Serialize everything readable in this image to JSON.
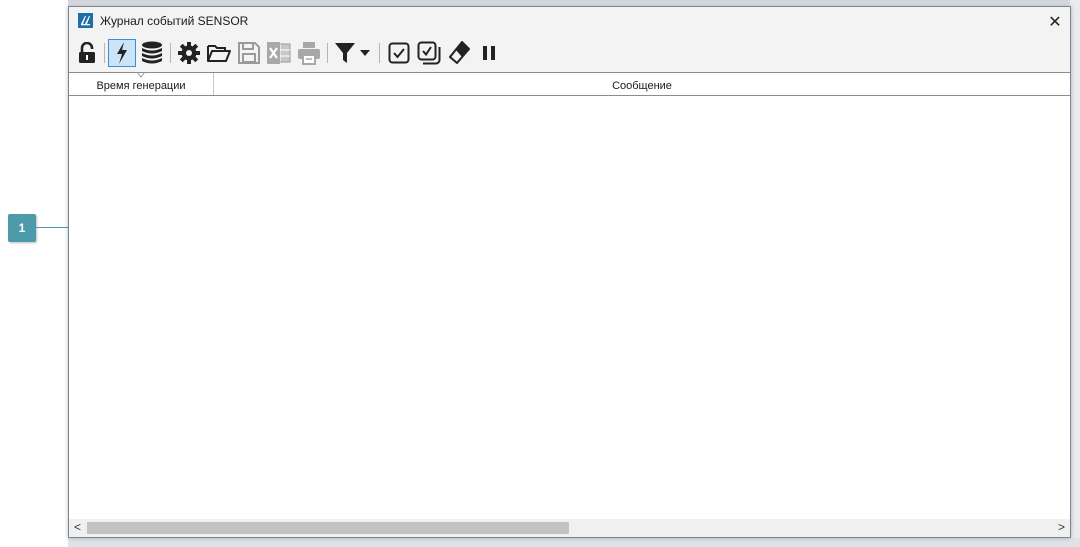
{
  "callout": {
    "number": "1"
  },
  "window": {
    "title": "Журнал событий SENSOR",
    "close_label": "✕"
  },
  "toolbar": {
    "icons": [
      "lock-icon",
      "lightning-icon",
      "database-icon",
      "gear-icon",
      "folder-open-icon",
      "save-icon",
      "excel-icon",
      "printer-icon",
      "filter-icon",
      "checkbox-icon",
      "checkbox-multi-icon",
      "eraser-icon",
      "pause-icon"
    ]
  },
  "grid": {
    "columns": [
      "Время генерации",
      "Сообщение"
    ],
    "sort_column": "Время генерации"
  },
  "scrollbar": {
    "left_arrow": "<",
    "right_arrow": ">"
  },
  "colors": {
    "callout": "#4d9aab",
    "active_button": "#cce4f7",
    "active_border": "#3c8dd6",
    "app_icon": "#1d6fa8"
  }
}
